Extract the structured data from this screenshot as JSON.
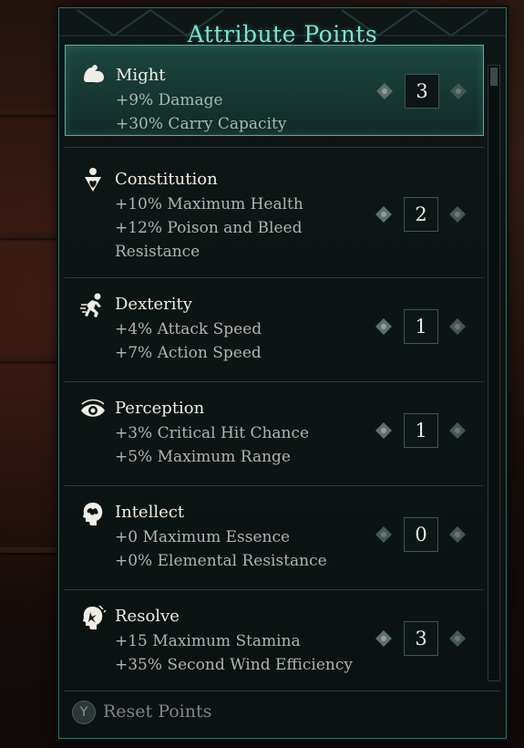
{
  "panel": {
    "title": "Attribute Points"
  },
  "attributes": [
    {
      "name": "Might",
      "icon": "flexed-arm-icon",
      "desc": [
        "+9% Damage",
        "+30% Carry Capacity"
      ],
      "value": "3"
    },
    {
      "name": "Constitution",
      "icon": "heart-body-icon",
      "desc": [
        "+10% Maximum Health",
        "+12% Poison and Bleed",
        "Resistance"
      ],
      "value": "2"
    },
    {
      "name": "Dexterity",
      "icon": "running-figure-icon",
      "desc": [
        "+4% Attack Speed",
        "+7% Action Speed"
      ],
      "value": "1"
    },
    {
      "name": "Perception",
      "icon": "eye-icon",
      "desc": [
        "+3% Critical Hit Chance",
        "+5% Maximum Range"
      ],
      "value": "1"
    },
    {
      "name": "Intellect",
      "icon": "brain-head-icon",
      "desc": [
        "+0 Maximum Essence",
        "+0% Elemental Resistance"
      ],
      "value": "0"
    },
    {
      "name": "Resolve",
      "icon": "resolve-head-icon",
      "desc": [
        "+15 Maximum Stamina",
        "+35% Second Wind Efficiency"
      ],
      "value": "3"
    }
  ],
  "footer": {
    "button_glyph": "Y",
    "reset_label": "Reset Points"
  },
  "colors": {
    "accent": "#7fe0cf",
    "selected_border": "#3fb8a2",
    "panel_bg": "#0e1616"
  }
}
